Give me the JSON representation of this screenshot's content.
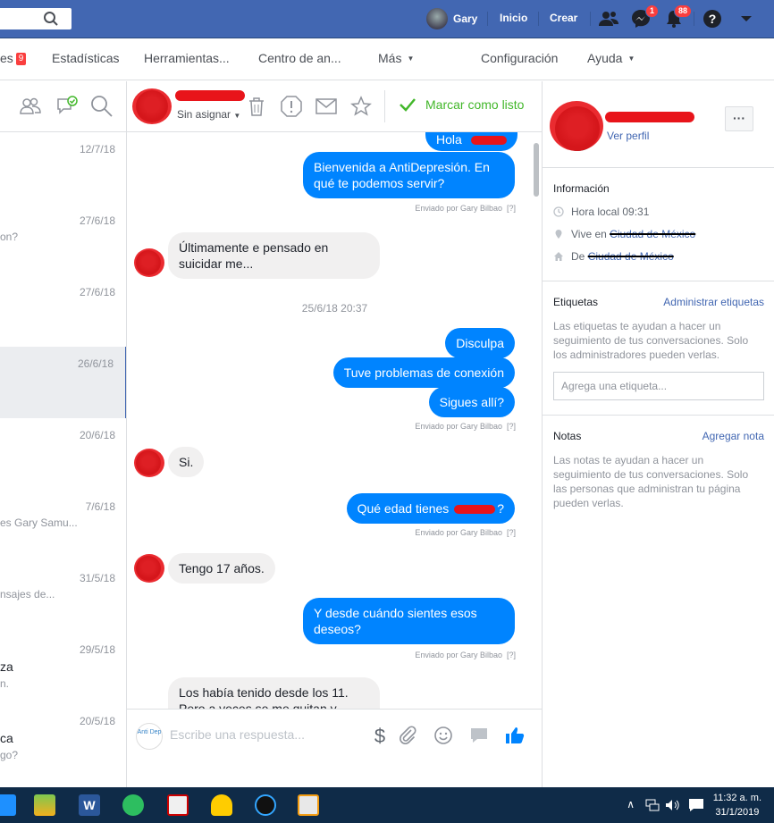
{
  "topbar": {
    "user_name": "Gary",
    "links": [
      "Inicio",
      "Crear"
    ],
    "messages_badge": "1",
    "notifications_badge": "88"
  },
  "pagenav": {
    "items": [
      "es",
      "Estadísticas",
      "Herramientas...",
      "Centro de an...",
      "Más",
      "Configuración",
      "Ayuda"
    ],
    "messages_badge": "9"
  },
  "left_list": {
    "conversations": [
      {
        "date": "12/7/18",
        "name": "",
        "snippet": ""
      },
      {
        "date": "27/6/18",
        "name": "",
        "snippet": "on?"
      },
      {
        "date": "27/6/18",
        "name": "",
        "snippet": ""
      },
      {
        "date": "26/6/18",
        "name": "",
        "snippet": ""
      },
      {
        "date": "20/6/18",
        "name": "",
        "snippet": ""
      },
      {
        "date": "7/6/18",
        "name": "",
        "snippet": "es Gary Samu..."
      },
      {
        "date": "31/5/18",
        "name": "",
        "snippet": "nsajes de..."
      },
      {
        "date": "29/5/18",
        "name": "za",
        "snippet": "n."
      },
      {
        "date": "20/5/18",
        "name": "ca",
        "snippet": "go?"
      }
    ]
  },
  "chat": {
    "assign_label": "Sin asignar",
    "mark_done_label": "Marcar como listo",
    "date_separator": "25/6/18 20:37",
    "messages": [
      {
        "dir": "out",
        "text": "Hola"
      },
      {
        "dir": "out",
        "text": "Bienvenida a AntiDepresión. En qué te podemos servir?"
      },
      {
        "dir": "in",
        "text": "Últimamente  e pensado en suicidar me..."
      },
      {
        "dir": "out",
        "text": "Disculpa"
      },
      {
        "dir": "out",
        "text": "Tuve problemas de conexión"
      },
      {
        "dir": "out",
        "text": "Sigues allí?"
      },
      {
        "dir": "in",
        "text": "Si."
      },
      {
        "dir": "out",
        "text": "Qué edad tienes"
      },
      {
        "dir": "in",
        "text": "Tengo 17 años."
      },
      {
        "dir": "out",
        "text": "Y desde cuándo sientes esos deseos?"
      },
      {
        "dir": "in",
        "text": "Los había tenido desde los 11. Pero a veces se me quitan y"
      }
    ],
    "sent_by": "Enviado por Gary Bilbao",
    "sent_by_help": "[?]",
    "composer_placeholder": "Escribe una respuesta...",
    "composer_logo_text": "Anti Dep"
  },
  "right_panel": {
    "profile_link": "Ver perfil",
    "more_button": "···",
    "info_title": "Información",
    "local_time": "Hora local 09:31",
    "lives_in_prefix": "Vive en",
    "lives_in_city": "Ciudad de México",
    "from_prefix": "De",
    "from_city": "Ciudad de México",
    "tags_title": "Etiquetas",
    "tags_action": "Administrar etiquetas",
    "tags_desc": "Las etiquetas te ayudan a hacer un seguimiento de tus conversaciones. Solo los administradores pueden verlas.",
    "tags_placeholder": "Agrega una etiqueta...",
    "notes_title": "Notas",
    "notes_action": "Agregar nota",
    "notes_desc": "Las notas te ayudan a hacer un seguimiento de tus conversaciones. Solo las personas que administran tu página pueden verlas."
  },
  "taskbar": {
    "time": "11:32 a. m.",
    "date": "31/1/2019"
  },
  "colors": {
    "fb_blue": "#4267b2",
    "messenger_blue": "#0084ff",
    "done_green": "#42b72a",
    "redaction_red": "#e8141a",
    "taskbar": "#0f2b48"
  }
}
